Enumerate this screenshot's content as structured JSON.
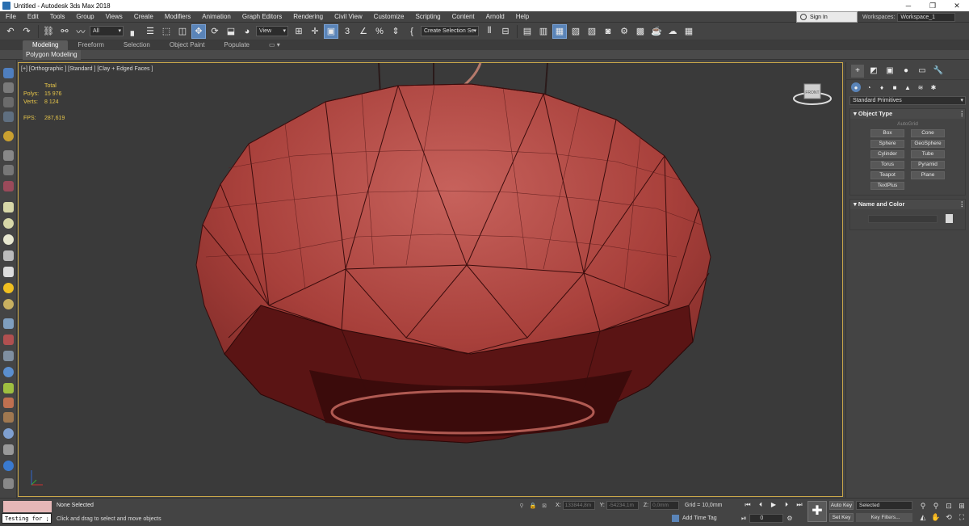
{
  "window": {
    "title": "Untitled - Autodesk 3ds Max 2018",
    "controls": [
      "─",
      "❐",
      "✕"
    ]
  },
  "menu": [
    "File",
    "Edit",
    "Tools",
    "Group",
    "Views",
    "Create",
    "Modifiers",
    "Animation",
    "Graph Editors",
    "Rendering",
    "Civil View",
    "Customize",
    "Scripting",
    "Content",
    "Arnold",
    "Help"
  ],
  "account": {
    "sign_in": "Sign In",
    "workspaces_label": "Workspaces:",
    "workspace": "Workspace_1"
  },
  "toolbar": {
    "filter": "All",
    "ref_coord": "View",
    "snaps_label": "3",
    "selection_set": "Create Selection Se"
  },
  "ribbon": {
    "tabs": [
      "Modeling",
      "Freeform",
      "Selection",
      "Object Paint",
      "Populate"
    ],
    "active_tab": "Modeling",
    "sub_label": "Polygon Modeling"
  },
  "viewport": {
    "label": "[+] [Orthographic ] [Standard ] [Clay + Edged Faces ]",
    "stats": {
      "header": "Total",
      "polys_label": "Polys:",
      "polys": "15 976",
      "verts_label": "Verts:",
      "verts": "8 124",
      "fps_label": "FPS:",
      "fps": "287,619"
    },
    "viewcube_label": "FRONT"
  },
  "command_panel": {
    "category": "Standard Primitives",
    "object_type_title": "Object Type",
    "autogrid": "AutoGrid",
    "objects": [
      "Box",
      "Cone",
      "Sphere",
      "GeoSphere",
      "Cylinder",
      "Tube",
      "Torus",
      "Pyramid",
      "Teapot",
      "Plane",
      "TextPlus"
    ],
    "name_color_title": "Name and Color"
  },
  "status": {
    "maxscript": "Testing for ;",
    "selection": "None Selected",
    "prompt": "Click and drag to select and move objects",
    "x_label": "X:",
    "x": "133844,8m",
    "y_label": "Y:",
    "y": "-54234,1m",
    "z_label": "Z:",
    "z": "0,0mm",
    "grid": "Grid = 10,0mm",
    "add_time_tag": "Add Time Tag",
    "frame": "0",
    "auto_key": "Auto Key",
    "set_key": "Set Key",
    "key_mode": "Selected",
    "key_filters": "Key Filters..."
  },
  "colors": {
    "model_fill": "#a8403b",
    "model_shadow": "#3b0b0b",
    "viewport_border": "#c9a74a",
    "active_blue": "#5a84b8"
  }
}
